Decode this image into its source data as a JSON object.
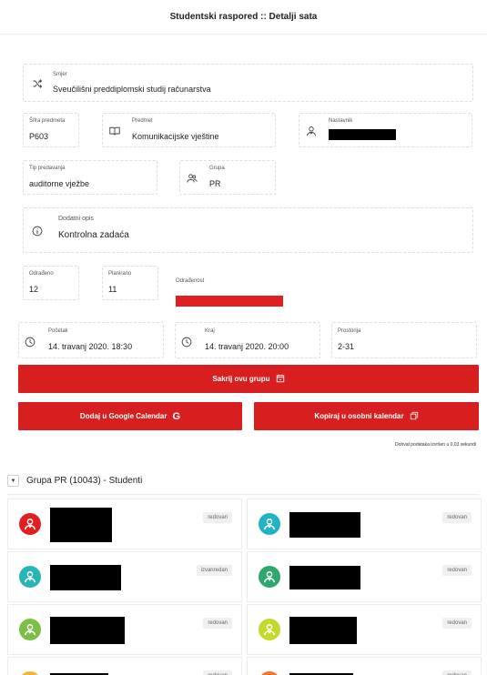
{
  "header": {
    "title": "Studentski raspored :: Detalji sata"
  },
  "fields": {
    "smjer": {
      "label": "Smjer",
      "value": "Sveučilišni preddiplomski studij računarstva",
      "icon": "shuffle-icon"
    },
    "sifra": {
      "label": "Šifra predmeta",
      "value": "P603"
    },
    "predmet": {
      "label": "Predmet",
      "value": "Komunikacijske vještine",
      "icon": "book-icon"
    },
    "nastavnik": {
      "label": "Nastavnik",
      "icon": "teacher-icon"
    },
    "tip": {
      "label": "Tip predavanja",
      "value": "auditorne vježbe"
    },
    "grupa": {
      "label": "Grupa",
      "value": "PR",
      "icon": "group-icon"
    },
    "opis": {
      "label": "Dodatni opis",
      "value": "Kontrolna zadaća",
      "icon": "info-icon"
    },
    "odradeno": {
      "label": "Odrađeno",
      "value": "12"
    },
    "planirano": {
      "label": "Planirano",
      "value": "11"
    },
    "odradenost": {
      "label": "Odrađenost",
      "progress": 1.0,
      "color": "#e02020"
    },
    "pocetak": {
      "label": "Početak",
      "value": "14. travanj 2020. 18:30",
      "icon": "clock-icon"
    },
    "kraj": {
      "label": "Kraj",
      "value": "14. travanj 2020. 20:00",
      "icon": "clock-icon"
    },
    "prostorija": {
      "label": "Prostorija",
      "value": "2-31"
    }
  },
  "buttons": {
    "hide_group": "Sakrij ovu grupu",
    "google": "Dodaj u Google Calendar",
    "copy": "Kopiraj u osobni kalendar"
  },
  "fetch_note": "Dohvat podataka izvršen u 0,03 sekundi",
  "group": {
    "title": "Grupa PR (10043) - Studenti",
    "students": [
      {
        "status": "redovan",
        "color": "#e02020"
      },
      {
        "status": "redovan",
        "color": "#22b3c7"
      },
      {
        "status": "izvanredan",
        "color": "#26b6b6"
      },
      {
        "status": "redovan",
        "color": "#2ea86e"
      },
      {
        "status": "redovan",
        "color": "#7bbf44"
      },
      {
        "status": "redovan",
        "color": "#c5d92c"
      },
      {
        "status": "redovan",
        "color": "#f5b72a"
      },
      {
        "status": "redovan",
        "color": "#ee7a2e"
      }
    ]
  },
  "colors": {
    "accent": "#d71f1f"
  }
}
